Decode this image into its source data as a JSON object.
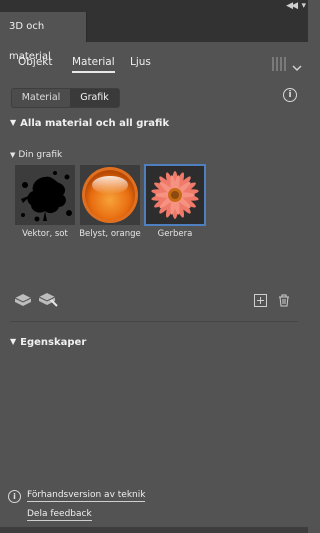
{
  "panel": {
    "tab_title": "3D och material"
  },
  "nav": {
    "items": [
      "Objekt",
      "Material",
      "Ljus"
    ],
    "active": "Material"
  },
  "segment": {
    "options": [
      "Material",
      "Grafik"
    ],
    "selected": "Grafik"
  },
  "sections": {
    "all": "Alla material och all grafik",
    "mine": "Din grafik",
    "properties": "Egenskaper"
  },
  "graphics": [
    {
      "label": "Vektor, sot"
    },
    {
      "label": "Belyst, orange"
    },
    {
      "label": "Gerbera"
    }
  ],
  "footer": {
    "preview": "Förhandsversion av teknik",
    "feedback": "Dela feedback"
  },
  "colors": {
    "selection": "#4f7fbf",
    "background": "#535353"
  }
}
